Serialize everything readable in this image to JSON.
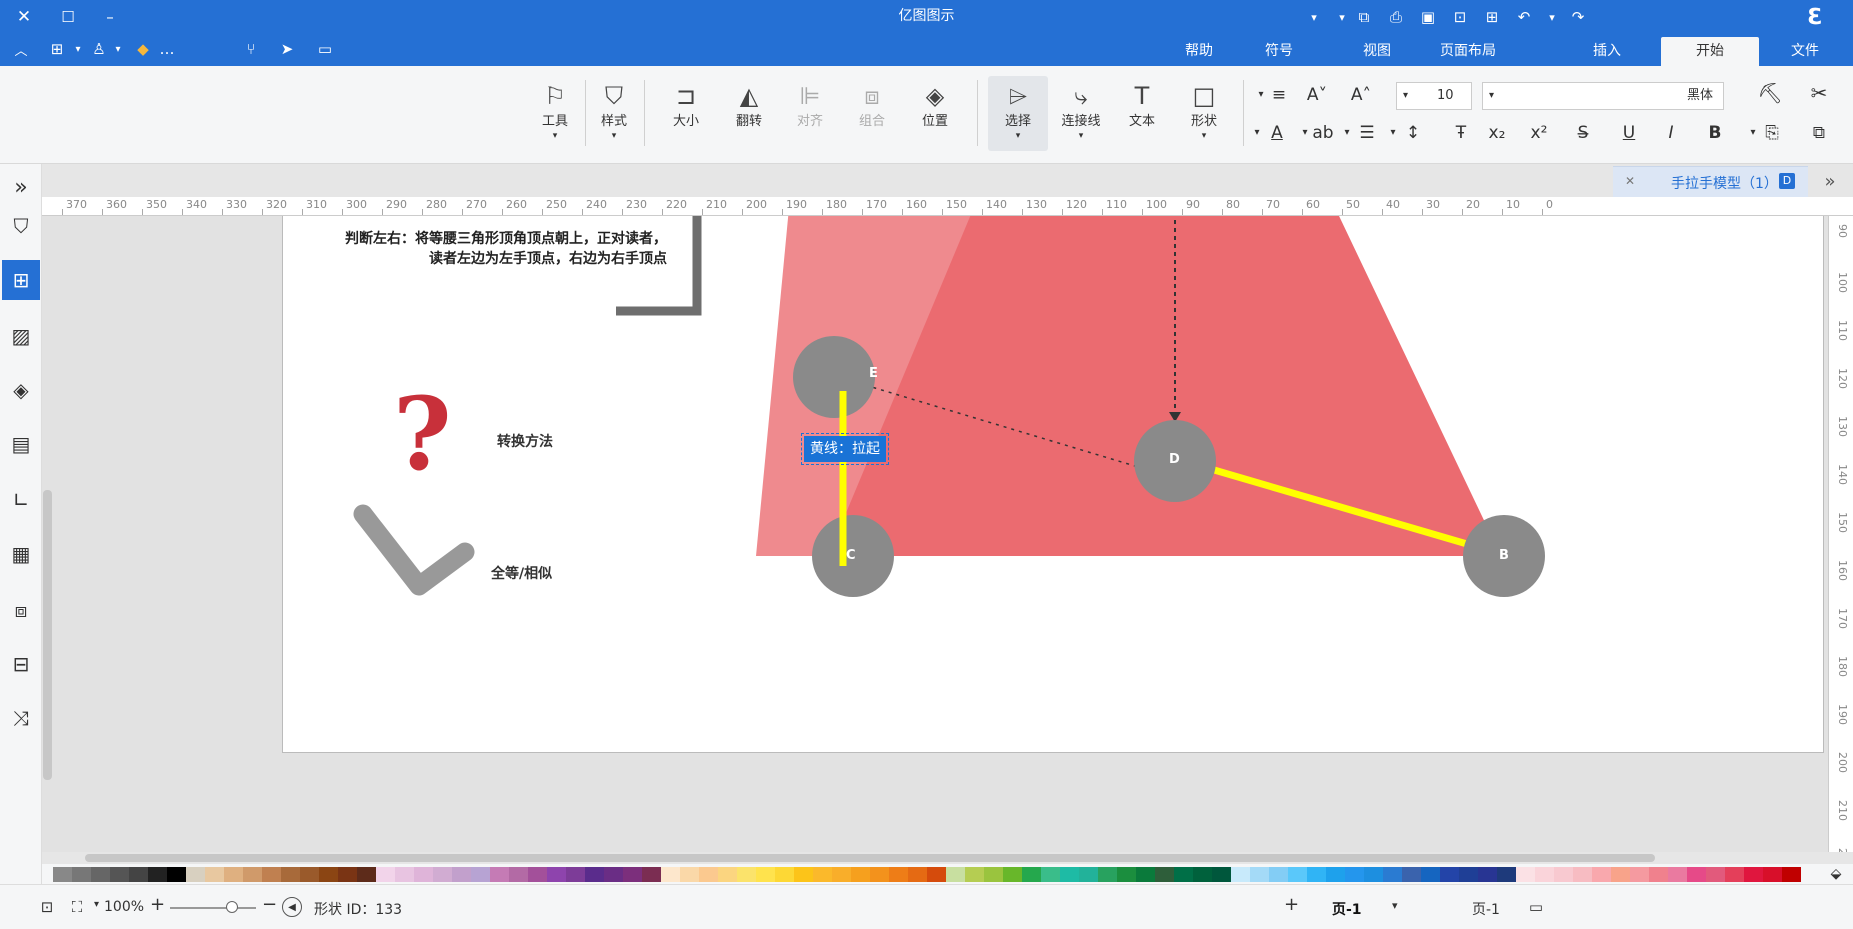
{
  "app": {
    "title": "亿图图示"
  },
  "tabs": [
    {
      "label": "文件"
    },
    {
      "label": "开始"
    },
    {
      "label": "插入"
    },
    {
      "label": "页面布局"
    },
    {
      "label": "视图"
    },
    {
      "label": "符号"
    },
    {
      "label": "帮助"
    }
  ],
  "ribbon": {
    "font_name": "黑体",
    "font_size": "10",
    "shape": "形状",
    "text": "文本",
    "connector": "连接线",
    "select": "选择",
    "position": "位置",
    "group": "组合",
    "align": "对齐",
    "rotate": "翻转",
    "size": "大小",
    "style": "样式",
    "tools": "工具"
  },
  "document": {
    "tab_name": "手拉手模型（1）"
  },
  "ruler": {
    "top_ticks": [
      "0",
      "10",
      "20",
      "30",
      "40",
      "50",
      "60",
      "70",
      "80",
      "90",
      "100",
      "110",
      "120",
      "130",
      "140",
      "150",
      "160",
      "170",
      "180",
      "190",
      "200",
      "210",
      "220",
      "230",
      "240",
      "250",
      "260",
      "270",
      "280",
      "290",
      "300",
      "310",
      "320",
      "330",
      "340",
      "350",
      "360",
      "370"
    ],
    "right_ticks": [
      "90",
      "100",
      "110",
      "120",
      "130",
      "140",
      "150",
      "160",
      "170",
      "180",
      "190",
      "200",
      "210",
      "220"
    ]
  },
  "diagram": {
    "text_block": [
      "判断左右：将等腰三角形顶角顶点朝上，正对读者，",
      "读者左边为左手顶点，右边为右手顶点"
    ],
    "method_label": "转换方法",
    "congruent_label": "全等/相似",
    "yellow_label": "黄线：拉起",
    "points": [
      {
        "label": "E"
      },
      {
        "label": "D"
      },
      {
        "label": "C"
      },
      {
        "label": "B"
      }
    ],
    "colors": {
      "triangle": "#eb6b70",
      "triangle_light": "#ef8a8e",
      "circle": "#8a8a8a",
      "yellow": "#ffff00",
      "gray": "#777777",
      "question": "#c8303a"
    }
  },
  "status": {
    "page_left": "页-1",
    "page_current": "页-1",
    "shape_id": "形状 ID：133",
    "zoom": "100%"
  },
  "palette": [
    "#c00000",
    "#d80f2a",
    "#e0163e",
    "#e43f5a",
    "#e25a7c",
    "#e64a88",
    "#ea7aa0",
    "#f0818d",
    "#f59aa0",
    "#f8a38a",
    "#f9a8ad",
    "#f7bcc2",
    "#f8c9d0",
    "#fad4da",
    "#fbe1e5",
    "#1e3a7b",
    "#283593",
    "#1f3f96",
    "#2344a8",
    "#1565c0",
    "#3a63ad",
    "#2a7bd2",
    "#1d8fe0",
    "#2496ed",
    "#1ea1ec",
    "#30b4f5",
    "#5ac8fa",
    "#83cdf5",
    "#a4daf7",
    "#c8eafb",
    "#00573c",
    "#00613c",
    "#006f47",
    "#2e5e3a",
    "#0a7a3b",
    "#1b8e3e",
    "#28a25f",
    "#22b29a",
    "#1ebba5",
    "#3abd8a",
    "#25a84d",
    "#68b72a",
    "#9ac43e",
    "#b5cd52",
    "#c8dfa0",
    "#d54b0c",
    "#e56a13",
    "#ee7d17",
    "#f3921c",
    "#f6a01e",
    "#f9ae2a",
    "#fbb92b",
    "#fcc419",
    "#fdd835",
    "#ffe34d",
    "#fbe36b",
    "#fbd580",
    "#fbc98f",
    "#fad8a8",
    "#fde7cc",
    "#7b2d52",
    "#7c2f7c",
    "#6a2d85",
    "#5a2c8c",
    "#7d3c98",
    "#8e44ad",
    "#a3509a",
    "#b36aa5",
    "#c57bb5",
    "#b7a3d3",
    "#c2a0cc",
    "#d1acd2",
    "#dfb4d9",
    "#e8c4e1",
    "#f2d4ea",
    "#5d2b1a",
    "#7a3414",
    "#8b4513",
    "#9a5a2b",
    "#a86a3a",
    "#c08050",
    "#d09a6a",
    "#dfb080",
    "#e8c8a0",
    "#d8d0c0",
    "#000000",
    "#222222",
    "#444444",
    "#555555",
    "#666666",
    "#777777",
    "#888888",
    "#999999",
    "#aaaaaa",
    "#bbbbbb",
    "#cccccc",
    "#dddddd",
    "#eeeeee",
    "#ffffff"
  ]
}
